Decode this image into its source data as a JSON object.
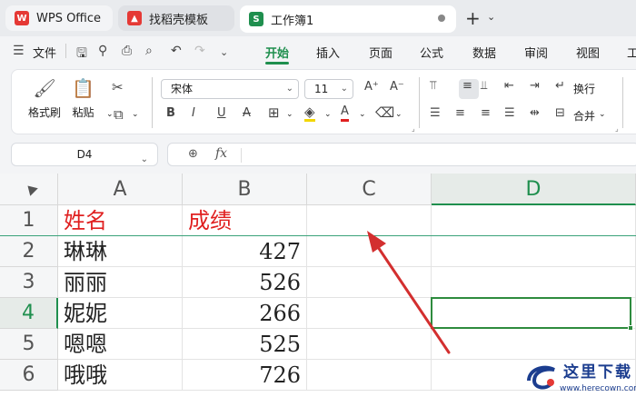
{
  "tabs": [
    {
      "label": "WPS Office",
      "icon": "wps-logo-icon"
    },
    {
      "label": "找稻壳模板",
      "icon": "docer-icon"
    },
    {
      "label": "工作簿1",
      "icon": "spreadsheet-icon",
      "icon_letter": "S"
    }
  ],
  "menu": {
    "file_label": "文件",
    "tabs": [
      "开始",
      "插入",
      "页面",
      "公式",
      "数据",
      "审阅",
      "视图",
      "工"
    ],
    "active_tab": "开始"
  },
  "ribbon": {
    "format_painter": "格式刷",
    "paste": "粘贴",
    "font_name": "宋体",
    "font_size": "11",
    "wrap_text": "换行",
    "merge": "合并"
  },
  "formula_bar": {
    "name_box": "D4",
    "fx_label": "fx",
    "formula": ""
  },
  "grid": {
    "columns": [
      "A",
      "B",
      "C",
      "D"
    ],
    "active_column": "D",
    "rows": [
      "1",
      "2",
      "3",
      "4",
      "5",
      "6"
    ],
    "active_row": "4",
    "cells": [
      [
        "姓名",
        "成绩"
      ],
      [
        "琳琳",
        "427"
      ],
      [
        "丽丽",
        "526"
      ],
      [
        "妮妮",
        "266"
      ],
      [
        "嗯嗯",
        "525"
      ],
      [
        "哦哦",
        "726"
      ]
    ],
    "selected_cell": "D4"
  },
  "colors": {
    "accent": "#1f8f4e",
    "header_text": "#e02020",
    "arrow": "#d32f2f"
  },
  "watermark": {
    "title": "这里下载",
    "url": "www.herecown.com"
  }
}
